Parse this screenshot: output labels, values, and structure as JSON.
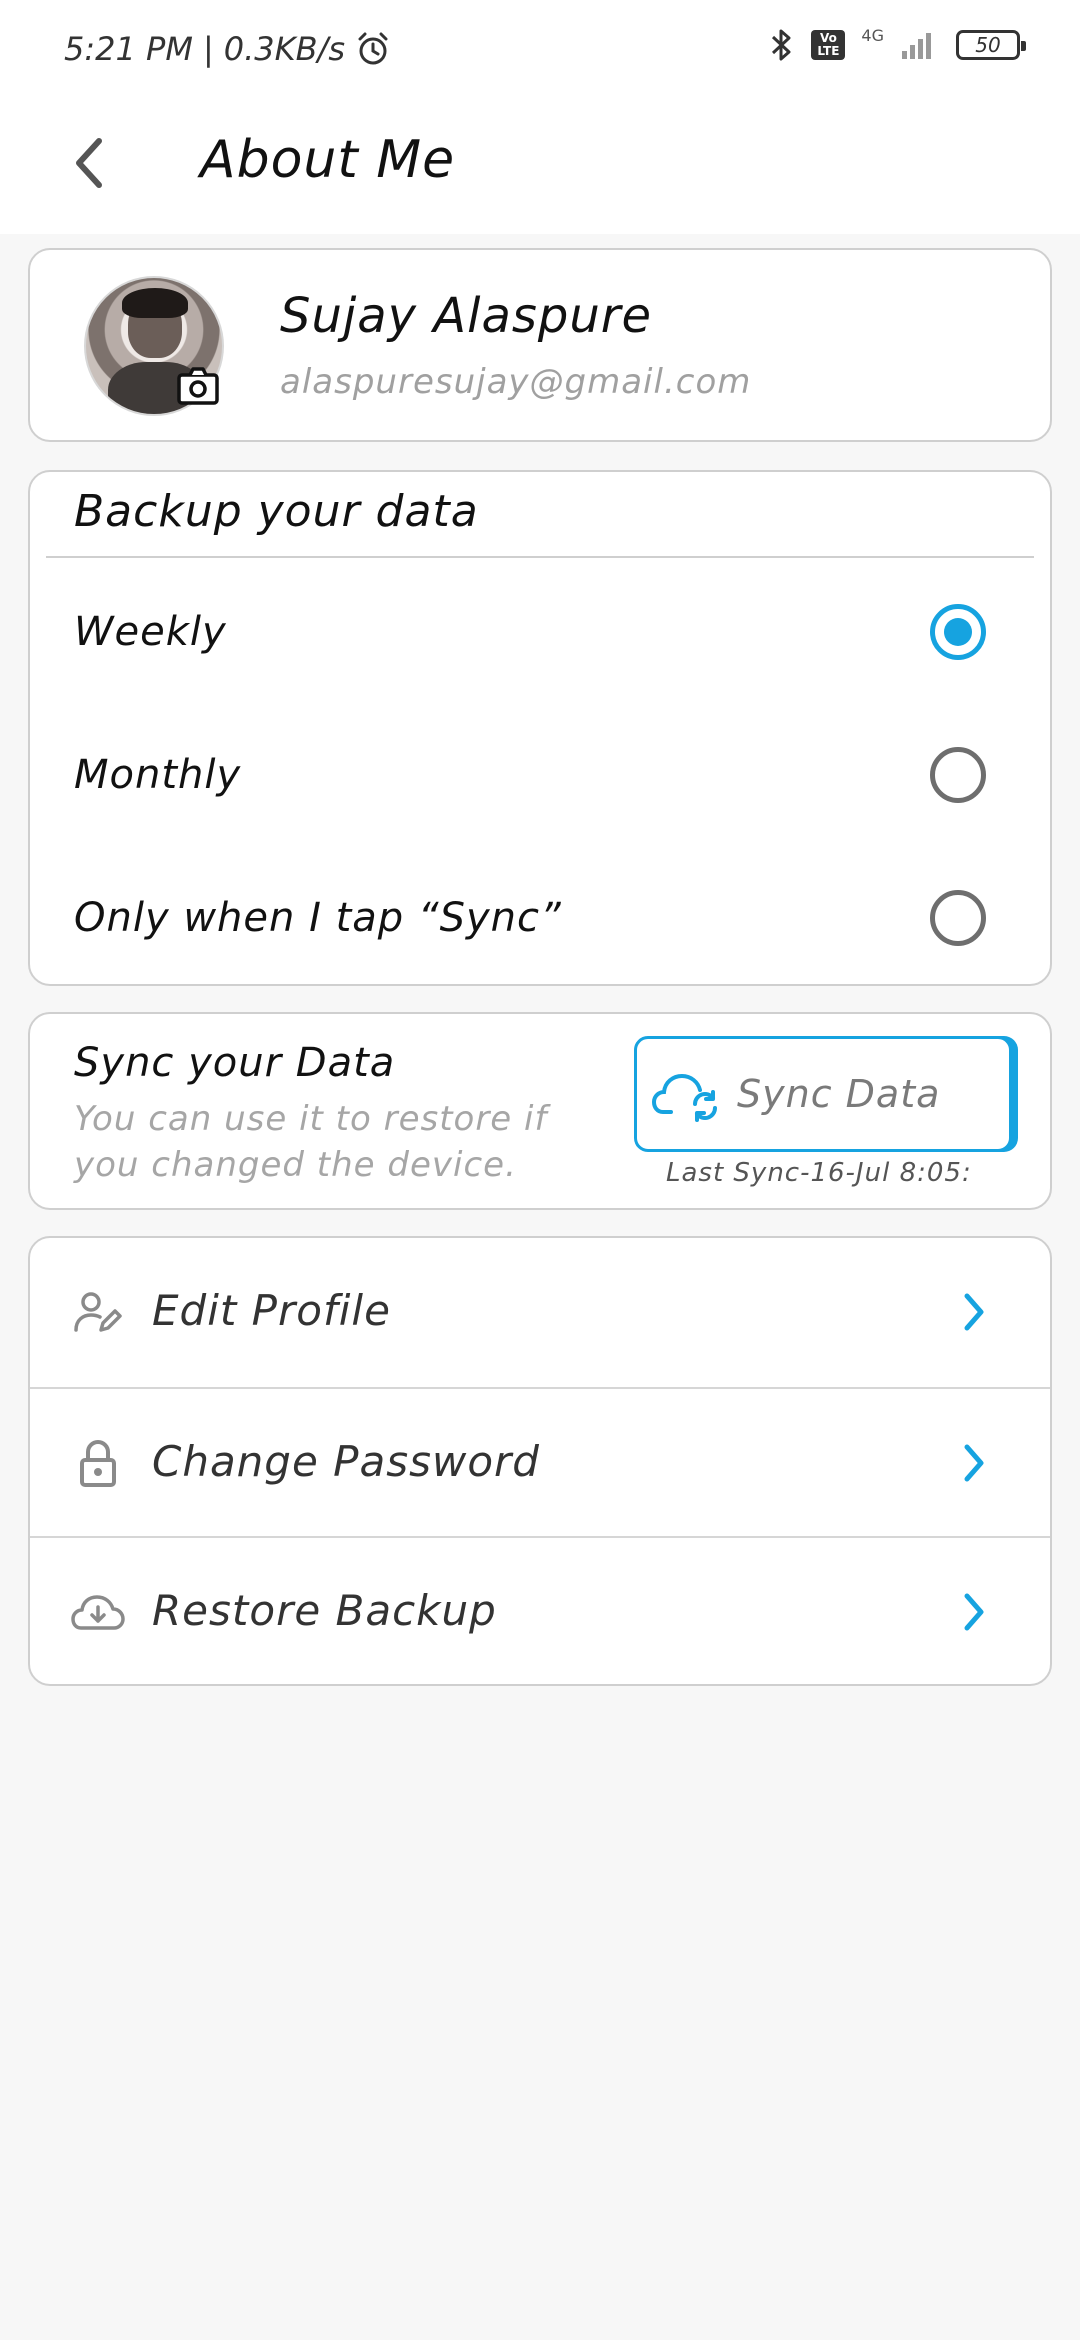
{
  "status_bar": {
    "time": "5:21 PM",
    "network_speed": "0.3KB/s",
    "separator": "|",
    "network_type": "4G",
    "volte_top": "Vo",
    "volte_bottom": "LTE",
    "battery": "50"
  },
  "app_bar": {
    "title": "About Me"
  },
  "profile": {
    "name": "Sujay Alaspure",
    "email": "alaspuresujay@gmail.com"
  },
  "backup": {
    "title": "Backup your data",
    "options": [
      {
        "label": "Weekly",
        "selected": true
      },
      {
        "label": "Monthly",
        "selected": false
      },
      {
        "label": "Only when I tap “Sync”",
        "selected": false
      }
    ]
  },
  "sync": {
    "title": "Sync your Data",
    "description": "You can use it to restore if you changed the device.",
    "button_label": "Sync Data",
    "last_sync": "Last Sync-16-Jul 8:05:"
  },
  "menu": {
    "items": [
      {
        "label": "Edit Profile",
        "icon": "edit-profile-icon"
      },
      {
        "label": "Change Password",
        "icon": "lock-icon"
      },
      {
        "label": "Restore Backup",
        "icon": "cloud-download-icon"
      }
    ]
  },
  "colors": {
    "accent": "#16a3e0",
    "text_primary": "#111111",
    "text_muted": "#a0a0a0",
    "card_border": "#cfcfcf",
    "background": "#f7f7f7"
  }
}
